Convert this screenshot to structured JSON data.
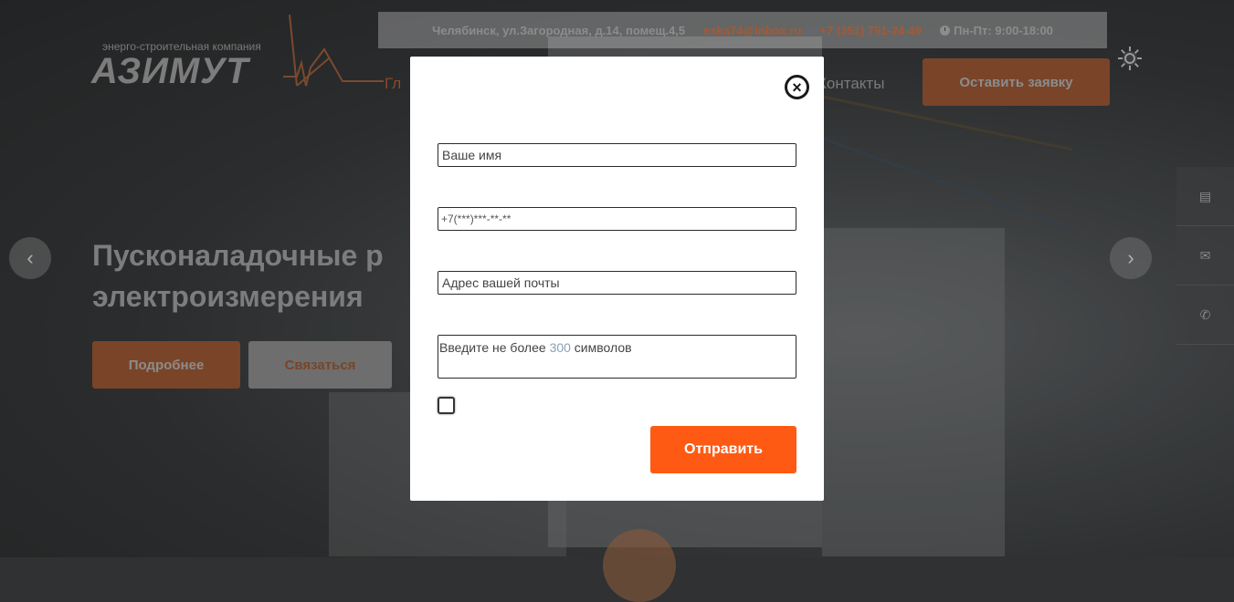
{
  "header": {
    "address": "Челябинск, ул.Загородная, д.14, помещ.4,5",
    "email": "eska74@inbox.ru",
    "phone": "+7 (351) 751-24-49",
    "hours": "Пн-Пт: 9:00-18:00",
    "logo_tagline": "энерго-строительная компания",
    "logo_name": "АЗИМУТ",
    "cta_label": "Оставить заявку",
    "accent_color": "#ff5a14"
  },
  "nav": {
    "main_fragment": "Гл",
    "contacts_label": "Контакты"
  },
  "hero": {
    "title_line1": "Пусконаладочные р",
    "title_line2": "электроизмерения",
    "more_label": "Подробнее",
    "contact_label": "Связаться",
    "prev_icon": "chevron-left-icon",
    "next_icon": "chevron-right-icon"
  },
  "side_panel": {
    "items": [
      {
        "icon": "clipboard-icon",
        "glyph": "▤"
      },
      {
        "icon": "mail-icon",
        "glyph": "✉"
      },
      {
        "icon": "phone-icon",
        "glyph": "✆"
      }
    ]
  },
  "modal": {
    "close_glyph": "×",
    "name_placeholder": "Ваше имя",
    "phone_mask": "+7(***)***-**-**",
    "email_placeholder": "Адрес вашей почты",
    "message_hint_prefix": "Введите не более ",
    "message_hint_number": "300",
    "message_hint_suffix": " символов",
    "agree_checked": false,
    "submit_label": "Отправить"
  }
}
